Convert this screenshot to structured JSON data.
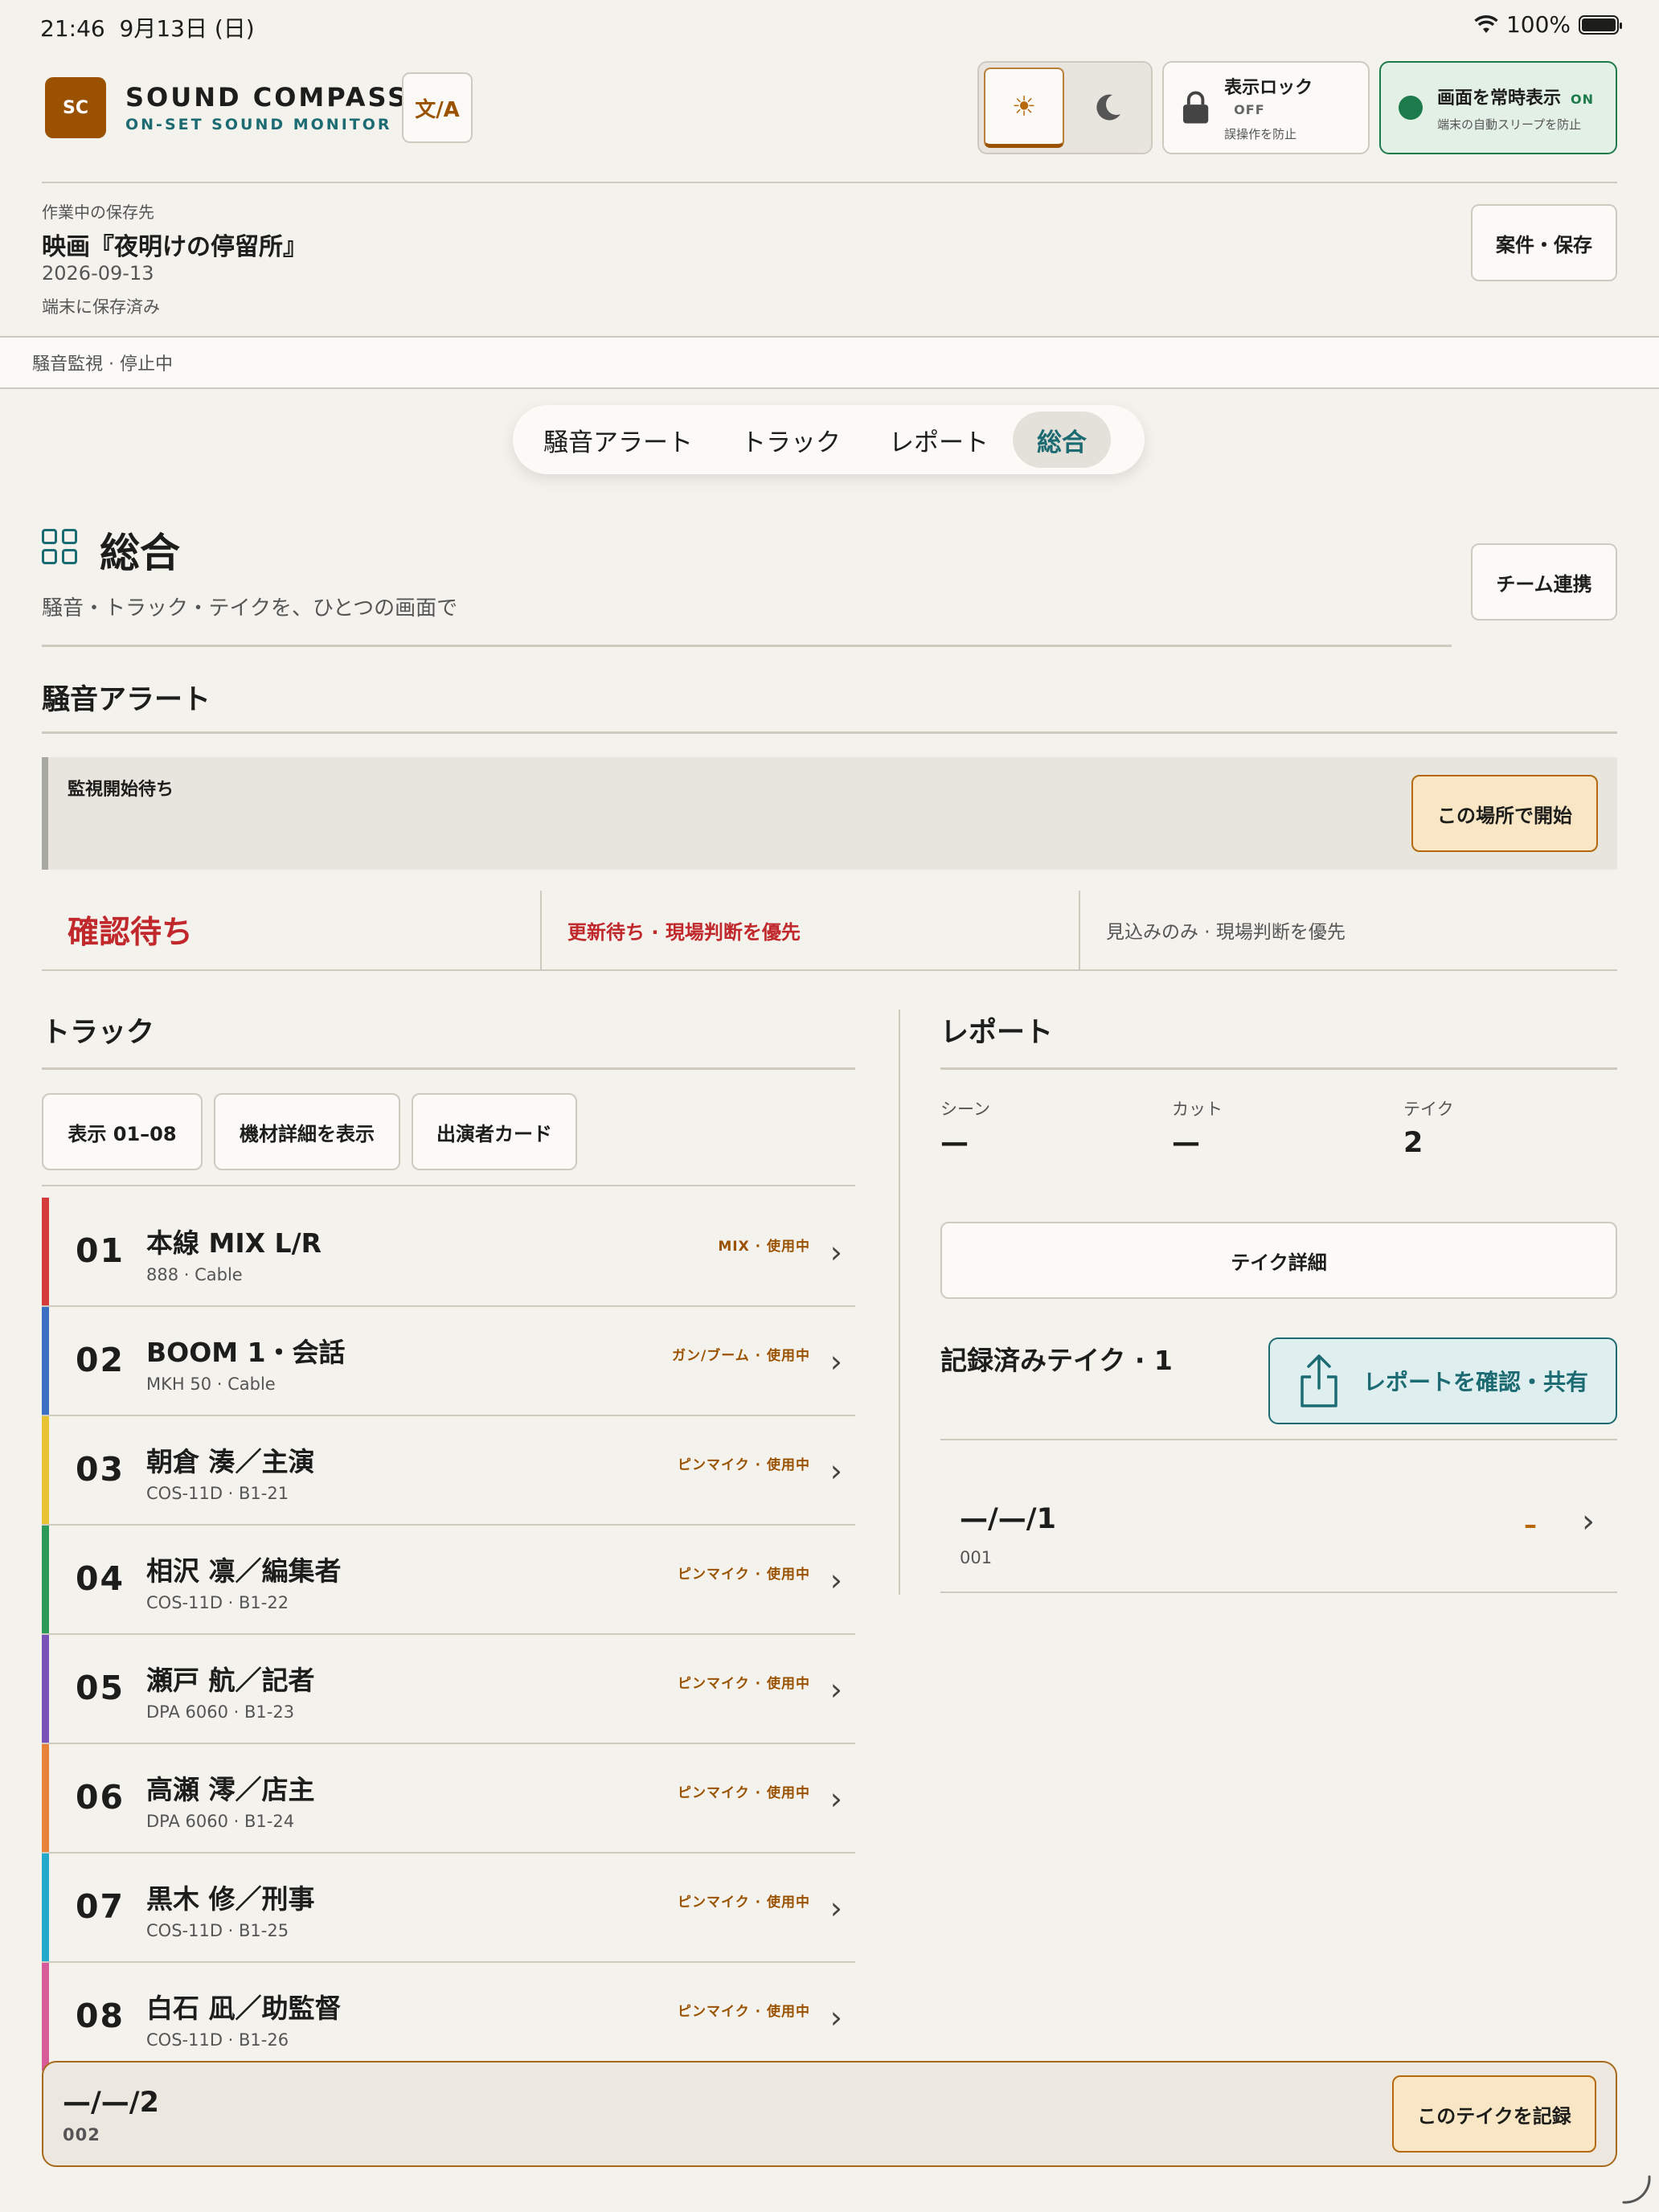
{
  "status_bar": {
    "time": "21:46",
    "date": "9月13日 (日)",
    "battery": "100%"
  },
  "header": {
    "logo": "SC",
    "brand_name": "SOUND COMPASS",
    "brand_sub": "ON-SET SOUND MONITOR",
    "lang_button": "文/A",
    "display_lock": {
      "title": "表示ロック",
      "state": "OFF",
      "sub": "誤操作を防止"
    },
    "always_on": {
      "title": "画面を常時表示",
      "state": "ON",
      "sub": "端末の自動スリープを防止"
    }
  },
  "project": {
    "label": "作業中の保存先",
    "title": "映画『夜明けの停留所』",
    "date": "2026-09-13",
    "saved": "端末に保存済み",
    "button": "案件・保存"
  },
  "monitor_status": "騒音監視 · 停止中",
  "tabs": [
    {
      "label": "騒音アラート",
      "active": false
    },
    {
      "label": "トラック",
      "active": false
    },
    {
      "label": "レポート",
      "active": false
    },
    {
      "label": "総合",
      "active": true
    }
  ],
  "summary": {
    "title": "総合",
    "subtitle": "騒音・トラック・テイクを、ひとつの画面で",
    "team_button": "チーム連携"
  },
  "noise": {
    "title": "騒音アラート",
    "watch_label": "監視開始待ち",
    "start_button": "この場所で開始",
    "status_main": "確認待ち",
    "status_update": "更新待ち · 現場判断を優先",
    "status_forecast": "見込みのみ · 現場判断を優先"
  },
  "tracks": {
    "title": "トラック",
    "buttons": [
      "表示 01–08",
      "機材詳細を表示",
      "出演者カード"
    ],
    "items": [
      {
        "num": "01",
        "name": "本線 MIX L/R",
        "device": "888 · Cable",
        "tag": "MIX · 使用中",
        "color": "#d63b3b"
      },
      {
        "num": "02",
        "name": "BOOM 1・会話",
        "device": "MKH 50 · Cable",
        "tag": "ガン/ブーム · 使用中",
        "color": "#3a6fc4"
      },
      {
        "num": "03",
        "name": "朝倉 湊／主演",
        "device": "COS-11D · B1-21",
        "tag": "ピンマイク · 使用中",
        "color": "#e8c233"
      },
      {
        "num": "04",
        "name": "相沢 凛／編集者",
        "device": "COS-11D · B1-22",
        "tag": "ピンマイク · 使用中",
        "color": "#2e9a58"
      },
      {
        "num": "05",
        "name": "瀬戸 航／記者",
        "device": "DPA 6060 · B1-23",
        "tag": "ピンマイク · 使用中",
        "color": "#7b52b8"
      },
      {
        "num": "06",
        "name": "高瀬 澪／店主",
        "device": "DPA 6060 · B1-24",
        "tag": "ピンマイク · 使用中",
        "color": "#e8843a"
      },
      {
        "num": "07",
        "name": "黒木 修／刑事",
        "device": "COS-11D · B1-25",
        "tag": "ピンマイク · 使用中",
        "color": "#22a9cc"
      },
      {
        "num": "08",
        "name": "白石 凪／助監督",
        "device": "COS-11D · B1-26",
        "tag": "ピンマイク · 使用中",
        "color": "#d85c9a"
      }
    ]
  },
  "report": {
    "title": "レポート",
    "scene_label": "シーン",
    "scene_value": "—",
    "cut_label": "カット",
    "cut_value": "—",
    "take_label": "テイク",
    "take_value": "2",
    "take_detail_button": "テイク詳細",
    "recorded_title": "記録済みテイク · 1",
    "share_button": "レポートを確認・共有",
    "record": {
      "id": "—/—/1",
      "num": "001",
      "mark": "–"
    }
  },
  "bottom": {
    "id": "—/—/2",
    "num": "002",
    "button": "このテイクを記録"
  }
}
